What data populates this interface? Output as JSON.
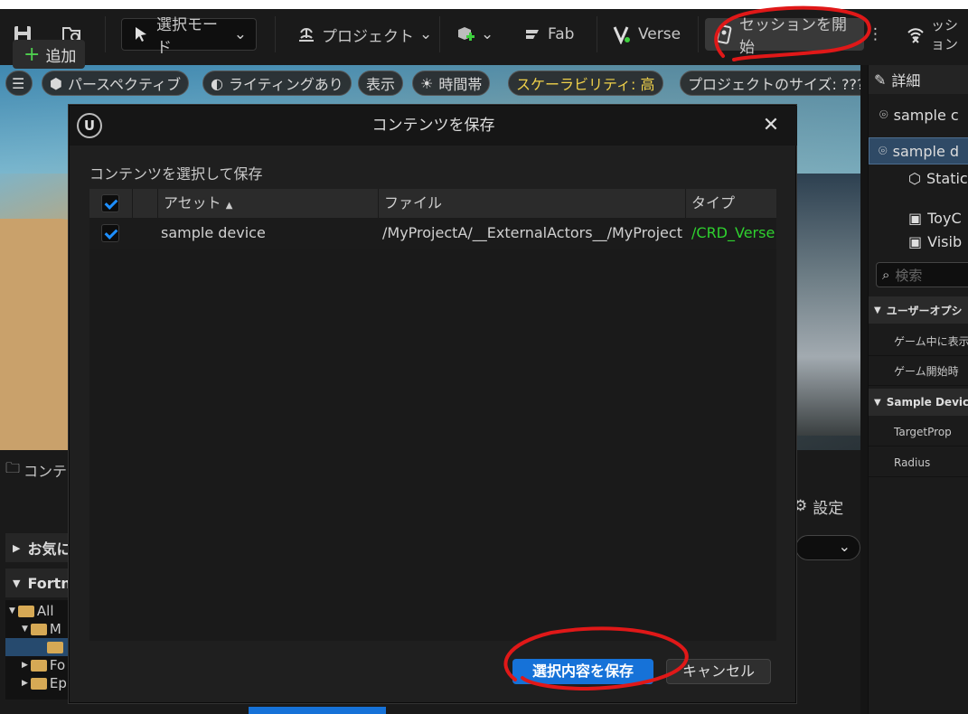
{
  "toolbar": {
    "selection_mode": "選択モード",
    "project": "プロジェクト",
    "fab": "Fab",
    "verse": "Verse",
    "start_session": "セッションを開始",
    "session_partial": "ッション",
    "more": "⋮"
  },
  "viewport": {
    "perspective": "パースペクティブ",
    "lighting": "ライティングあり",
    "show": "表示",
    "time_of_day": "時間帯",
    "scalability": "スケーラビリティ: 高",
    "project_size": "プロジェクトのサイズ: ???"
  },
  "content_browser": {
    "tab": "コンテ",
    "add": "追加",
    "settings": "設定",
    "favorites": "お気に",
    "fortnite": "Fortn",
    "tree": [
      "All",
      "M",
      "",
      "Fo",
      "Ep"
    ]
  },
  "details": {
    "title": "詳細",
    "actor_name": "sample c",
    "tree_items": [
      "sample d",
      "Static",
      "ToyC",
      "Visib"
    ],
    "search_placeholder": "検索",
    "categories": [
      "ユーザーオプシ",
      "Sample Device"
    ],
    "props": [
      "ゲーム中に表示",
      "ゲーム開始時",
      "TargetProp",
      "Radius"
    ]
  },
  "dialog": {
    "title": "コンテンツを保存",
    "close": "✕",
    "subtitle": "コンテンツを選択して保存",
    "columns": {
      "asset": "アセット",
      "file": "ファイル",
      "type": "タイプ"
    },
    "rows": [
      {
        "checked": true,
        "asset": "sample device",
        "file": "/MyProjectA/__ExternalActors__/MyProject",
        "type": "/CRD_Verse"
      }
    ],
    "save_button": "選択内容を保存",
    "cancel_button": "キャンセル"
  },
  "colors": {
    "accent": "#1672d8",
    "checkmark": "#1e8fff",
    "type_text": "#2fd12f",
    "highlight_chip": "#f0d14a",
    "annotation": "#e01818"
  }
}
